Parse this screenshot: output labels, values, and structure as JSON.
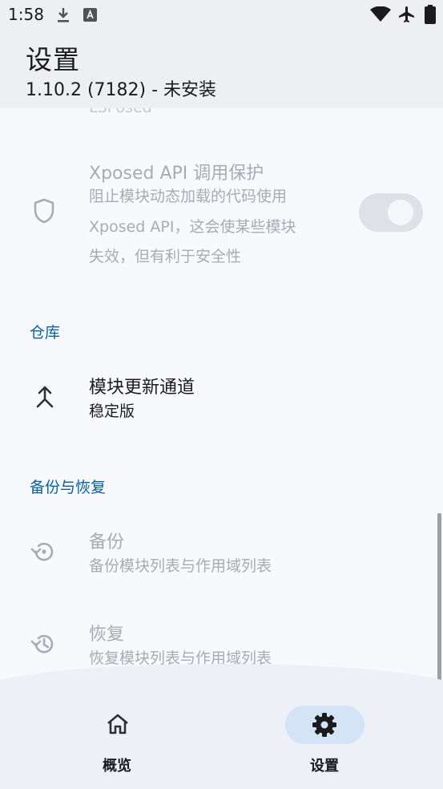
{
  "status_bar": {
    "time": "1:58",
    "left_icons": [
      "download-icon",
      "a-badge-icon"
    ],
    "right_icons": [
      "wifi-icon",
      "airplane-mode-icon",
      "battery-icon"
    ]
  },
  "app_bar": {
    "title": "设置",
    "subtitle": "1.10.2 (7182) - 未安装"
  },
  "content": {
    "clipped_text": "LSPosed",
    "xposed_api_protection": {
      "title": "Xposed API 调用保护",
      "summary_lines": [
        "阻止模块动态加载的代码使用",
        "Xposed API，这会使某些模块",
        "失效，但有利于安全性"
      ],
      "icon": "shield-icon",
      "switch_on": true,
      "enabled": false
    },
    "repo_section": {
      "header": "仓库",
      "update_channel": {
        "title": "模块更新通道",
        "summary": "稳定版",
        "icon": "merge-arrow-icon"
      }
    },
    "backup_section": {
      "header": "备份与恢复",
      "backup": {
        "title": "备份",
        "summary": "备份模块列表与作用域列表",
        "icon": "backup-icon"
      },
      "restore": {
        "title": "恢复",
        "summary": "恢复模块列表与作用域列表",
        "icon": "restore-history-icon"
      }
    }
  },
  "bottom_nav": {
    "items": [
      {
        "label": "概览",
        "icon": "home-icon",
        "selected": false
      },
      {
        "label": "设置",
        "icon": "gear-icon",
        "selected": true
      }
    ]
  },
  "colors": {
    "accent": "#0a5f96",
    "indicator": "#d4e4f6",
    "background": "#f8f9fc",
    "app_bar": "#eeeff2"
  }
}
